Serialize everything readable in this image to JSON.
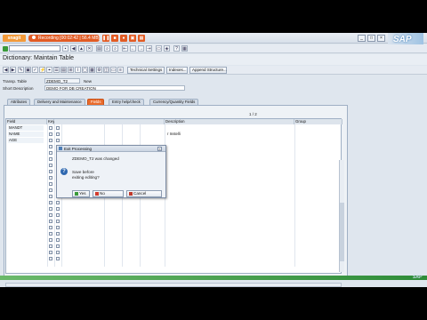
{
  "recorder": {
    "brand": "snagit",
    "label": "Recording [00:02:42 | 56.4 MB]",
    "pause_icon": "pause-icon",
    "stop_icon": "stop-icon",
    "mic_icon": "mic-icon",
    "camera_icon": "camera-icon",
    "grid_icon": "grid-icon"
  },
  "window": {
    "sap_logo": "SAP",
    "minimize": "_",
    "maximize": "□",
    "close": "×"
  },
  "command_field": {
    "value": ""
  },
  "page": {
    "title": "Dictionary: Maintain Table"
  },
  "toolbar": {
    "technical_settings": "Technical Settings",
    "indexes": "Indexes...",
    "append_structure": "Append Structure..."
  },
  "header": {
    "transp_table_label": "Transp. Table",
    "transp_table_value": "ZDEMO_T2",
    "status": "New",
    "short_desc_label": "Short Description",
    "short_desc_value": "DEMO FOR DB CREATION"
  },
  "tabs": [
    {
      "label": "Attributes",
      "active": false
    },
    {
      "label": "Delivery and Maintenance",
      "active": false
    },
    {
      "label": "Fields",
      "active": true
    },
    {
      "label": "Entry help/check",
      "active": false
    },
    {
      "label": "Currency/Quantity Fields",
      "active": false
    }
  ],
  "pager": "1 / 2",
  "grid": {
    "columns": [
      "Field",
      "Key",
      "Description",
      "Group"
    ],
    "rows": [
      {
        "field": "MANDT",
        "desc": ""
      },
      {
        "field": "NAME",
        "desc": "r Instelli"
      },
      {
        "field": "AGE",
        "desc": ""
      }
    ]
  },
  "dialog": {
    "title": "Exit Processing",
    "line1": "ZDEMO_T2 was changed",
    "line2": "Save before",
    "line3": "exiting editing?",
    "yes": "Yes",
    "no": "No",
    "cancel": "Cancel"
  },
  "status_bar": {
    "logo": "SAP"
  },
  "colors": {
    "accent": "#e96a2a",
    "status": "#2e8c38",
    "brand": "#f29a3a"
  }
}
